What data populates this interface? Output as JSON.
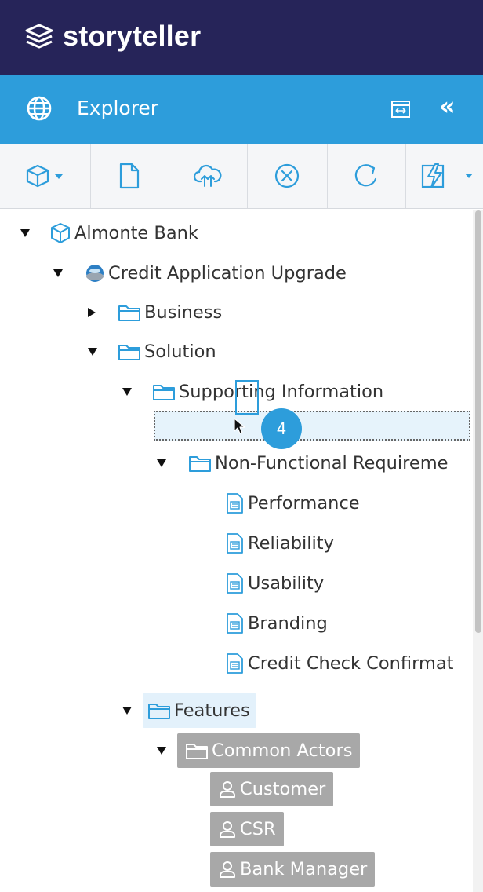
{
  "brand": {
    "name": "storyteller"
  },
  "explorer": {
    "title": "Explorer",
    "collapse_label": "«"
  },
  "toolbar": {
    "buttons": [
      "cube-dropdown",
      "new-document",
      "upload",
      "delete",
      "refresh",
      "generate-dropdown"
    ]
  },
  "tree": {
    "root": "Almonte Bank",
    "project": "Credit Application Upgrade",
    "business": "Business",
    "solution": "Solution",
    "supporting": "Supporting Information",
    "nfr": "Non-Functional Requireme",
    "nfr_items": [
      "Performance",
      "Reliability",
      "Usability",
      "Branding",
      "Credit Check Confirmat"
    ],
    "features": "Features",
    "common_actors": "Common Actors",
    "actors": [
      "Customer",
      "CSR",
      "Bank Manager"
    ]
  },
  "drag": {
    "count": "4"
  },
  "colors": {
    "brand_bg": "#262459",
    "accent": "#2d9ddb",
    "folder": "#2d9ddb",
    "pill": "#a8a8a8"
  }
}
